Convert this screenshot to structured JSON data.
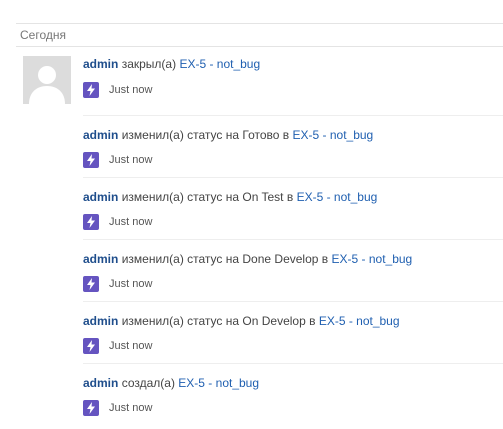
{
  "section": {
    "date_label": "Сегодня"
  },
  "entries": [
    {
      "user": "admin",
      "action": "закрыл(а)",
      "issue": "EX-5 - not_bug",
      "time": "Just now",
      "icon": "lightning-icon"
    },
    {
      "user": "admin",
      "action": "изменил(а) статус на Готово в",
      "issue": "EX-5 - not_bug",
      "time": "Just now",
      "icon": "lightning-icon"
    },
    {
      "user": "admin",
      "action": "изменил(а) статус на On Test в",
      "issue": "EX-5 - not_bug",
      "time": "Just now",
      "icon": "lightning-icon"
    },
    {
      "user": "admin",
      "action": "изменил(а) статус на Done Develop в",
      "issue": "EX-5 - not_bug",
      "time": "Just now",
      "icon": "lightning-icon"
    },
    {
      "user": "admin",
      "action": "изменил(а) статус на On Develop в",
      "issue": "EX-5 - not_bug",
      "time": "Just now",
      "icon": "lightning-icon"
    },
    {
      "user": "admin",
      "action": "создал(а)",
      "issue": "EX-5 - not_bug",
      "time": "Just now",
      "icon": "lightning-icon"
    }
  ],
  "colors": {
    "user_link": "#1f4e8c",
    "issue_link": "#1f5fb0",
    "bolt_badge": "#6554c0"
  }
}
